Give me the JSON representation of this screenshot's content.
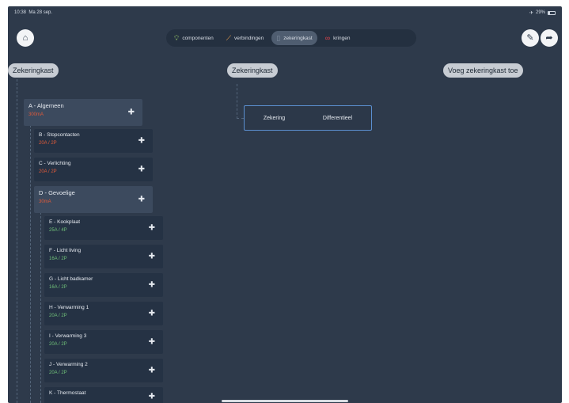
{
  "status": {
    "time": "10:38",
    "date": "Ma 28 sep.",
    "battery": "29%"
  },
  "tabs": [
    {
      "label": "componenten",
      "icon": "bulb-icon",
      "color": "#9fd36b",
      "active": false
    },
    {
      "label": "verbindingen",
      "icon": "wire-icon",
      "color": "#f3a34a",
      "active": false
    },
    {
      "label": "zekeringkast",
      "icon": "panel-icon",
      "color": "#7f8da0",
      "active": true
    },
    {
      "label": "kringen",
      "icon": "rings-icon",
      "color": "#e0434a",
      "active": false
    }
  ],
  "panels": {
    "left_title": "Zekeringkast",
    "center_title": "Zekeringkast",
    "add_title": "Voeg zekeringkast toe",
    "center_options": [
      "Zekering",
      "Differentieel"
    ]
  },
  "tree": [
    {
      "name": "A - Algemeen",
      "rating": "300mA",
      "type": "diff"
    },
    {
      "name": "B - Stopcontacten",
      "rating": "20A / 2P",
      "type": "fuse"
    },
    {
      "name": "C - Verlichting",
      "rating": "20A / 2P",
      "type": "fuse"
    },
    {
      "name": "D - Gevoelige",
      "rating": "30mA",
      "type": "diff"
    },
    {
      "name": "E - Kookplaat",
      "rating": "25A / 4P",
      "type": "fuse"
    },
    {
      "name": "F - Licht living",
      "rating": "16A / 2P",
      "type": "fuse"
    },
    {
      "name": "G - Licht badkamer",
      "rating": "16A / 2P",
      "type": "fuse"
    },
    {
      "name": "H - Verwarming 1",
      "rating": "20A / 2P",
      "type": "fuse"
    },
    {
      "name": "I - Verwarming 3",
      "rating": "20A / 2P",
      "type": "fuse"
    },
    {
      "name": "J - Verwarming 2",
      "rating": "20A / 2P",
      "type": "fuse"
    },
    {
      "name": "K - Thermostaat",
      "rating": "",
      "type": "fuse"
    }
  ],
  "icons": {
    "home": "home-icon",
    "edit": "pencil-icon",
    "share": "share-icon",
    "add": "plus-icon"
  }
}
